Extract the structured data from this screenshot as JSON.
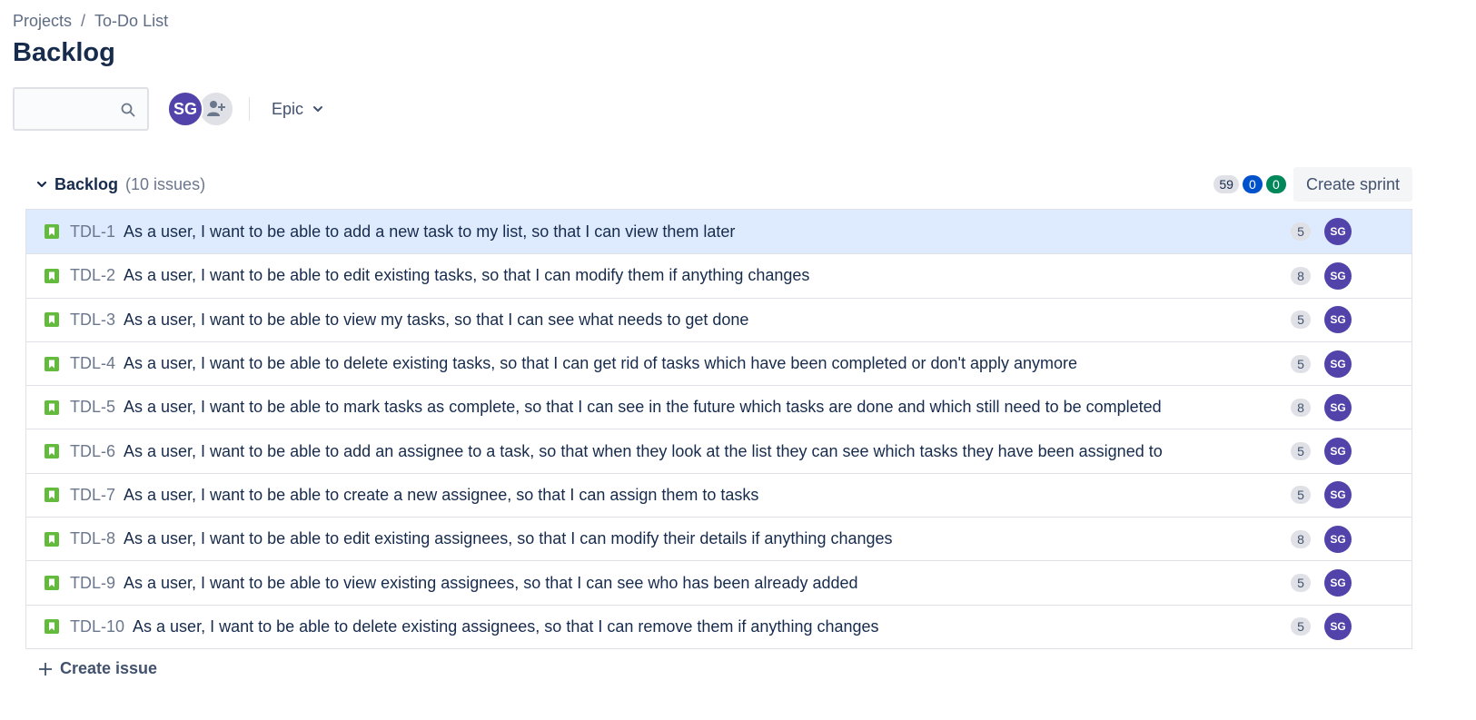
{
  "breadcrumb": {
    "projects": "Projects",
    "separator": "/",
    "project": "To-Do List"
  },
  "page": {
    "title": "Backlog"
  },
  "search": {
    "value": "",
    "placeholder": "",
    "icon": "search-icon"
  },
  "people": {
    "avatar_initials": "SG",
    "add_icon": "add-person-icon"
  },
  "filters": {
    "epic_label": "Epic"
  },
  "backlog": {
    "label": "Backlog",
    "issue_count": "(10 issues)",
    "status_counts": {
      "todo": "59",
      "in_progress": "0",
      "done": "0"
    },
    "create_sprint_label": "Create sprint",
    "issues": [
      {
        "key": "TDL-1",
        "summary": "As a user, I want to be able to add a new task to my list, so that I can view them later",
        "points": "5",
        "assignee": "SG"
      },
      {
        "key": "TDL-2",
        "summary": "As a user, I want to be able to edit existing tasks, so that I can modify them if anything changes",
        "points": "8",
        "assignee": "SG"
      },
      {
        "key": "TDL-3",
        "summary": "As a user, I want to be able to view my tasks, so that I can see what needs to get done",
        "points": "5",
        "assignee": "SG"
      },
      {
        "key": "TDL-4",
        "summary": "As a user, I want to be able to delete existing tasks, so that I can get rid of tasks which have been completed or don't apply anymore",
        "points": "5",
        "assignee": "SG"
      },
      {
        "key": "TDL-5",
        "summary": "As a user, I want to be able to mark tasks as complete, so that I can see in the future which tasks are done and which still need to be completed",
        "points": "8",
        "assignee": "SG"
      },
      {
        "key": "TDL-6",
        "summary": "As a user, I want to be able to add an assignee to a task, so that when they look at the list they can see which tasks they have been assigned to",
        "points": "5",
        "assignee": "SG"
      },
      {
        "key": "TDL-7",
        "summary": "As a user, I want to be able to create a new assignee, so that I can assign them to tasks",
        "points": "5",
        "assignee": "SG"
      },
      {
        "key": "TDL-8",
        "summary": "As a user, I want to be able to edit existing assignees, so that I can modify their details if anything changes",
        "points": "8",
        "assignee": "SG"
      },
      {
        "key": "TDL-9",
        "summary": "As a user, I want to be able to view existing assignees, so that I can see who has been already added",
        "points": "5",
        "assignee": "SG"
      },
      {
        "key": "TDL-10",
        "summary": "As a user, I want to be able to delete existing assignees, so that I can remove them if anything changes",
        "points": "5",
        "assignee": "SG"
      }
    ],
    "create_issue_label": "Create issue"
  },
  "colors": {
    "story": "#63ba3c",
    "avatar": "#5243aa",
    "selected_row": "#deebff",
    "todo_pill": "#dfe1e6",
    "in_progress_pill": "#0052cc",
    "done_pill": "#00875a"
  }
}
